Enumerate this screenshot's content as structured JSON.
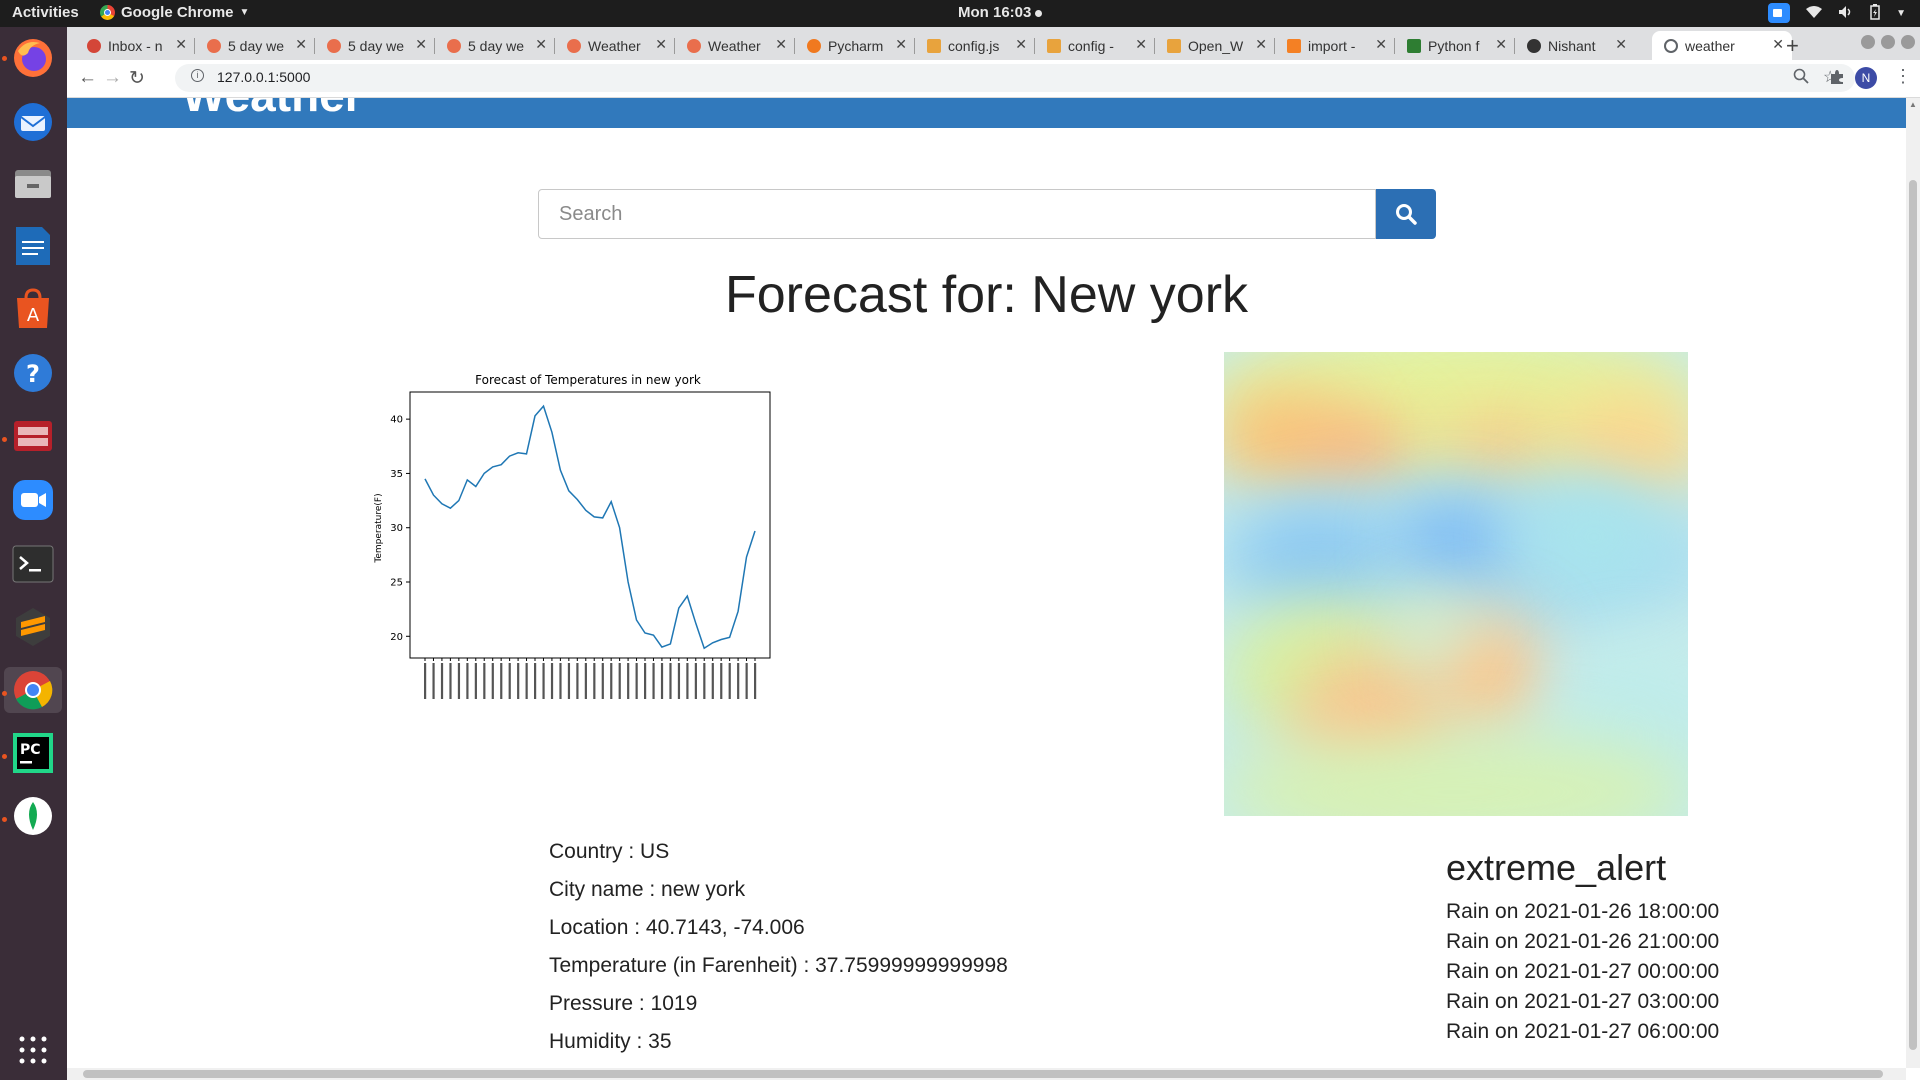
{
  "system_bar": {
    "activities": "Activities",
    "app_name": "Google Chrome",
    "clock": "Mon 16:03"
  },
  "dock": {
    "items": [
      "firefox-icon",
      "thunderbird-icon",
      "files-icon",
      "writer-icon",
      "software-icon",
      "help-icon",
      "app-red-icon",
      "zoom-icon",
      "terminal-icon",
      "sublime-icon",
      "chrome-icon",
      "pycharm-icon",
      "mongodb-icon"
    ]
  },
  "browser": {
    "tabs": [
      {
        "label": "Inbox - n",
        "favicon_color": "#d44638"
      },
      {
        "label": "5 day we",
        "favicon_color": "#e96e4c"
      },
      {
        "label": "5 day we",
        "favicon_color": "#e96e4c"
      },
      {
        "label": "5 day we",
        "favicon_color": "#e96e4c"
      },
      {
        "label": "Weather",
        "favicon_color": "#e96e4c"
      },
      {
        "label": "Weather",
        "favicon_color": "#e96e4c"
      },
      {
        "label": "Pycharm",
        "favicon_color": "#f0791f"
      },
      {
        "label": "config.js",
        "favicon_color": "#e8a33d"
      },
      {
        "label": "config -",
        "favicon_color": "#e8a33d"
      },
      {
        "label": "Open_W",
        "favicon_color": "#e8a33d"
      },
      {
        "label": "import -",
        "favicon_color": "#f48024"
      },
      {
        "label": "Python f",
        "favicon_color": "#2e7d32"
      },
      {
        "label": "Nishant",
        "favicon_color": "#333333"
      },
      {
        "label": "weather",
        "favicon_color": "#5f6368"
      }
    ],
    "active_tab_index": 13,
    "url": "127.0.0.1:5000",
    "profile_initial": "N"
  },
  "page": {
    "brand": "Weather",
    "search_placeholder": "Search",
    "title": "Forecast for: New york",
    "info": {
      "country": "Country : US",
      "city": "City name : new york",
      "location": "Location : 40.7143, -74.006",
      "temperature": "Temperature (in Farenheit) : 37.75999999999998",
      "pressure": "Pressure : 1019",
      "humidity": "Humidity : 35"
    },
    "alerts": {
      "heading": "extreme_alert",
      "items": [
        "Rain on 2021-01-26 18:00:00",
        "Rain on 2021-01-26 21:00:00",
        "Rain on 2021-01-27 00:00:00",
        "Rain on 2021-01-27 03:00:00",
        "Rain on 2021-01-27 06:00:00"
      ]
    }
  },
  "colors": {
    "navbar": "#3179bc",
    "search_button": "#2c6fb4",
    "line": "#1f77b4"
  },
  "chart_data": {
    "type": "line",
    "title": "Forecast of Temperatures in new york",
    "xlabel": "",
    "ylabel": "Temperature(F)",
    "ylim": [
      18,
      42.5
    ],
    "yticks": [
      20,
      25,
      30,
      35,
      40
    ],
    "x_tick_labels_legible": false,
    "values": [
      34.5,
      33.0,
      32.2,
      31.8,
      32.5,
      34.4,
      33.8,
      35.0,
      35.6,
      35.8,
      36.6,
      36.9,
      36.8,
      40.3,
      41.2,
      38.8,
      35.3,
      33.4,
      32.6,
      31.6,
      31.0,
      30.9,
      32.4,
      30.0,
      25.0,
      21.5,
      20.3,
      20.1,
      19.0,
      19.3,
      22.6,
      23.7,
      21.2,
      18.9,
      19.4,
      19.7,
      19.9,
      22.3,
      27.3,
      29.7
    ]
  }
}
